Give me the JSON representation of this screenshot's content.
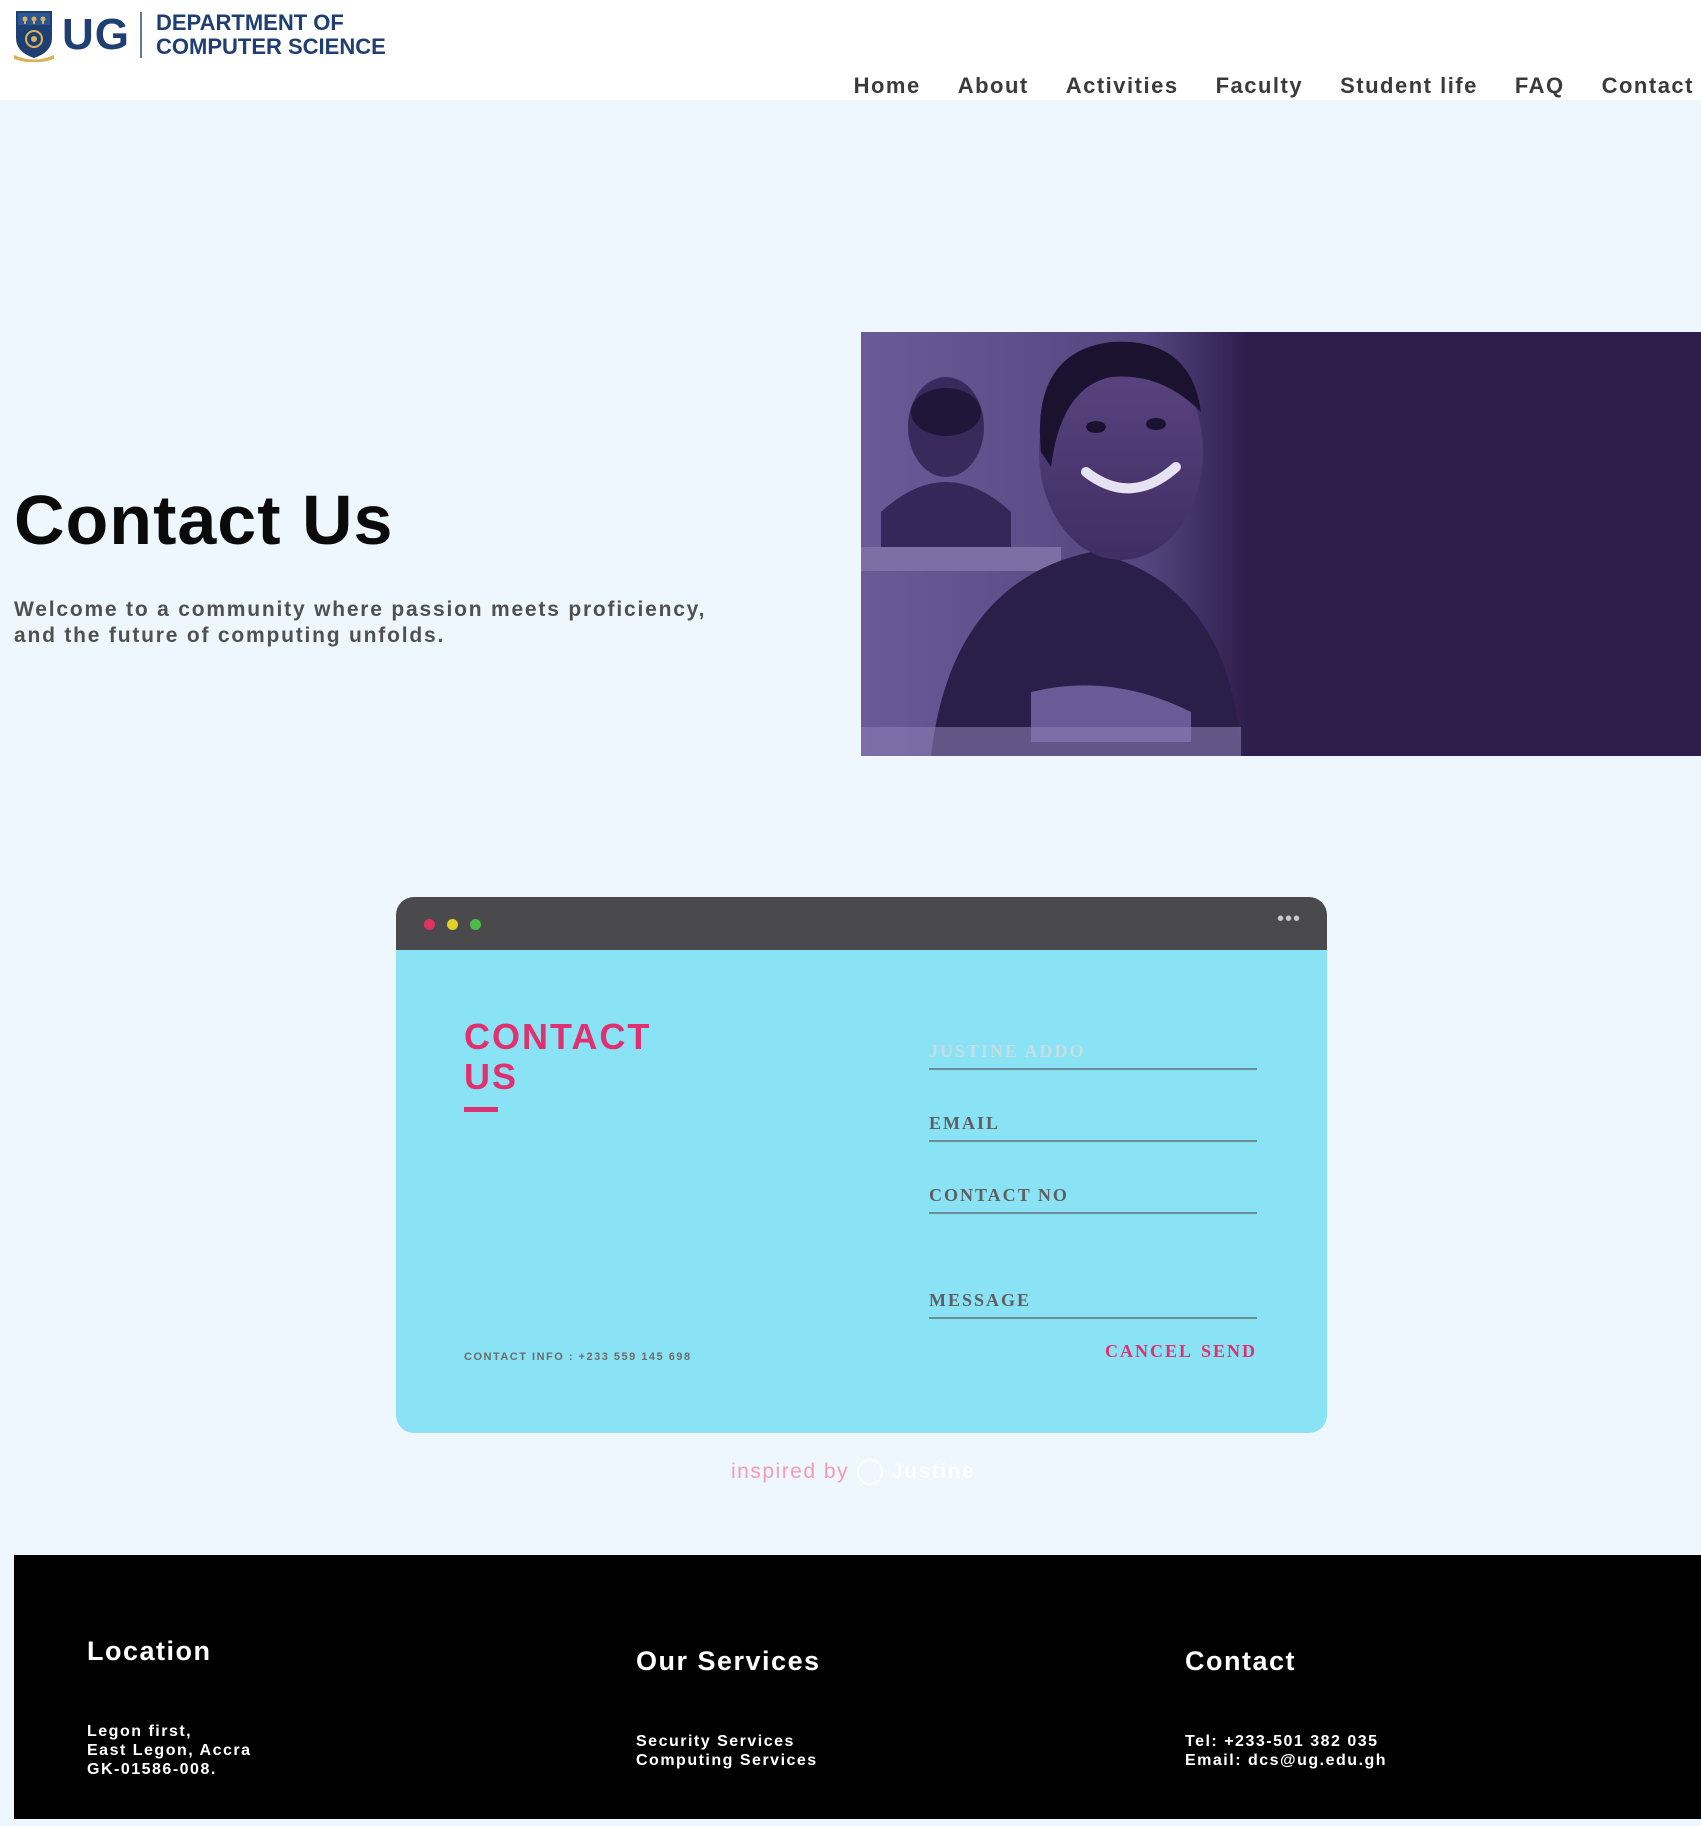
{
  "header": {
    "logo_abbr": "UG",
    "logo_line1": "DEPARTMENT OF",
    "logo_line2": "COMPUTER SCIENCE",
    "nav": [
      "Home",
      "About",
      "Activities",
      "Faculty",
      "Student life",
      "FAQ",
      "Contact"
    ]
  },
  "hero": {
    "title": "Contact Us",
    "subtitle_line1": "Welcome to a community where passion meets proficiency,",
    "subtitle_line2": "and the future of computing unfolds."
  },
  "contact_window": {
    "menu_icon": "ellipsis-icon",
    "heading_line1": "CONTACT",
    "heading_line2": "US",
    "contact_info": "CONTACT INFO : +233 559 145 698",
    "fields": {
      "name_placeholder": "JUSTINE ADDO",
      "email_placeholder": "EMAIL",
      "phone_placeholder": "CONTACT NO",
      "message_placeholder": "MESSAGE"
    },
    "cancel_label": "CANCEL",
    "send_label": "SEND"
  },
  "credit": {
    "prefix": "inspired by",
    "icon": "dribbble-icon",
    "name": "Justine"
  },
  "footer": {
    "location": {
      "heading": "Location",
      "lines": [
        "Legon first,",
        "East Legon, Accra",
        "GK-01586-008."
      ]
    },
    "services": {
      "heading": "Our Services",
      "lines": [
        "Security Services",
        "Computing Services"
      ]
    },
    "contact": {
      "heading": "Contact",
      "lines": [
        "Tel: +233-501 382 035",
        "Email: dcs@ug.edu.gh"
      ]
    }
  },
  "colors": {
    "page_bg": "#eef6fe",
    "brand_blue": "#1f3f73",
    "accent_pink": "#e0306f",
    "card_cyan": "#8ae3f5",
    "hero_purple": "#2f1d4c",
    "footer_bg": "#000000"
  }
}
